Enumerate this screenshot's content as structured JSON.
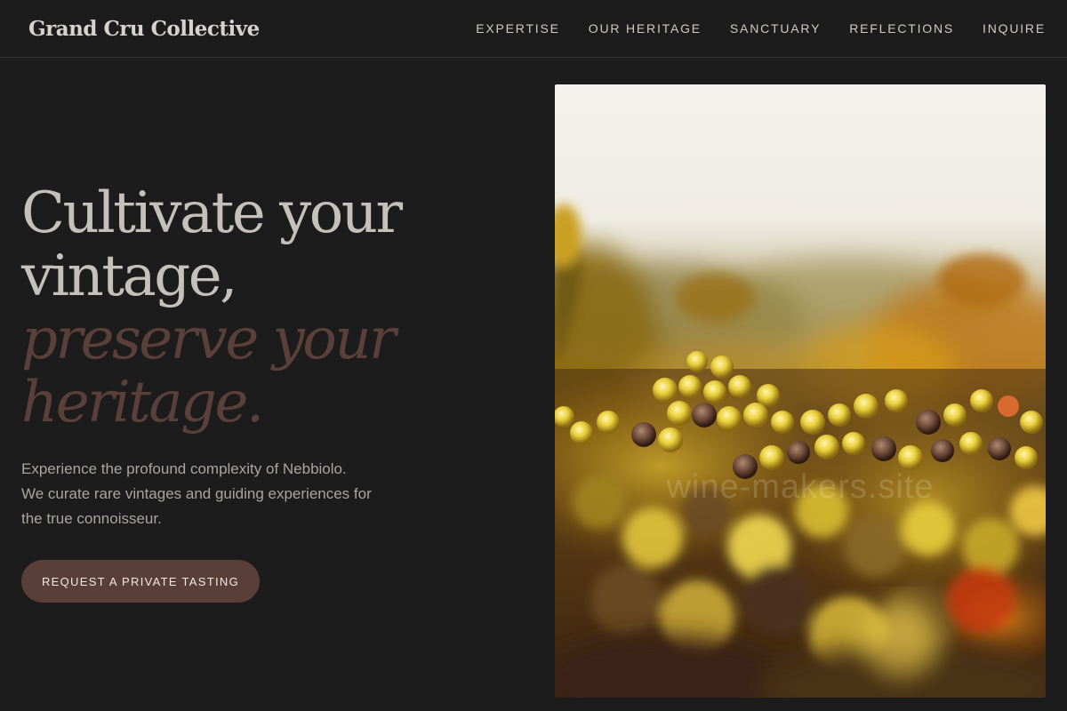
{
  "header": {
    "brand": "Grand Cru Collective",
    "nav": [
      "EXPERTISE",
      "OUR HERITAGE",
      "SANCTUARY",
      "REFLECTIONS",
      "INQUIRE"
    ]
  },
  "hero": {
    "headline_plain": [
      "Cultivate your",
      "vintage,"
    ],
    "headline_accent": [
      "preserve your",
      "heritage."
    ],
    "lede": [
      "Experience the profound complexity of Nebbiolo.",
      "We curate rare vintages and guiding experiences for",
      "the true connoisseur."
    ],
    "cta_label": "REQUEST A PRIVATE TASTING",
    "image": {
      "subject": "harvested-grapes-photo",
      "watermark": "wine-makers.site"
    }
  },
  "colors": {
    "background": "#1c1c1c",
    "accent": "#5a3f38",
    "headline": "#c4c0ba",
    "headline_accent": "#5a4039"
  }
}
